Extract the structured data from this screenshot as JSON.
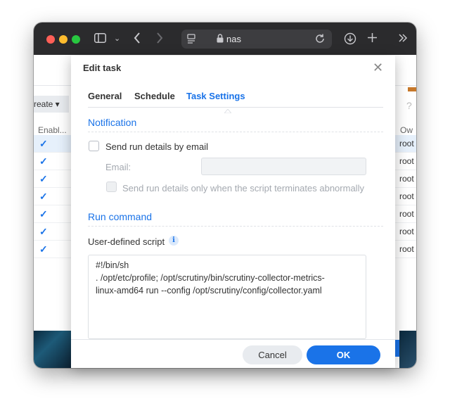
{
  "browser": {
    "url": "nas"
  },
  "background": {
    "create_label": "reate ▾",
    "enabled_header": "Enabl...",
    "owner_header": "Ow",
    "rows": [
      {
        "owner": "root"
      },
      {
        "owner": "root"
      },
      {
        "owner": "root"
      },
      {
        "owner": "root"
      },
      {
        "owner": "root"
      },
      {
        "owner": "root"
      },
      {
        "owner": "root"
      }
    ],
    "help_glyph": "?"
  },
  "dialog": {
    "title": "Edit task",
    "close_glyph": "✕",
    "tabs": [
      {
        "label": "General"
      },
      {
        "label": "Schedule"
      },
      {
        "label": "Task Settings"
      }
    ],
    "notification": {
      "title": "Notification",
      "send_email_label": "Send run details by email",
      "email_label": "Email:",
      "email_value": "",
      "abnormal_label": "Send run details only when the script terminates abnormally"
    },
    "run_command": {
      "title": "Run command",
      "script_label": "User-defined script",
      "info_glyph": "i",
      "script_lines": [
        "#!/bin/sh",
        ". /opt/etc/profile; /opt/scrutiny/bin/scrutiny-collector-metrics-",
        "linux-amd64 run --config /opt/scrutiny/config/collector.yaml"
      ]
    },
    "buttons": {
      "cancel": "Cancel",
      "ok": "OK"
    }
  },
  "colors": {
    "accent": "#1a73e8",
    "titlebar": "#2b2b2d"
  }
}
